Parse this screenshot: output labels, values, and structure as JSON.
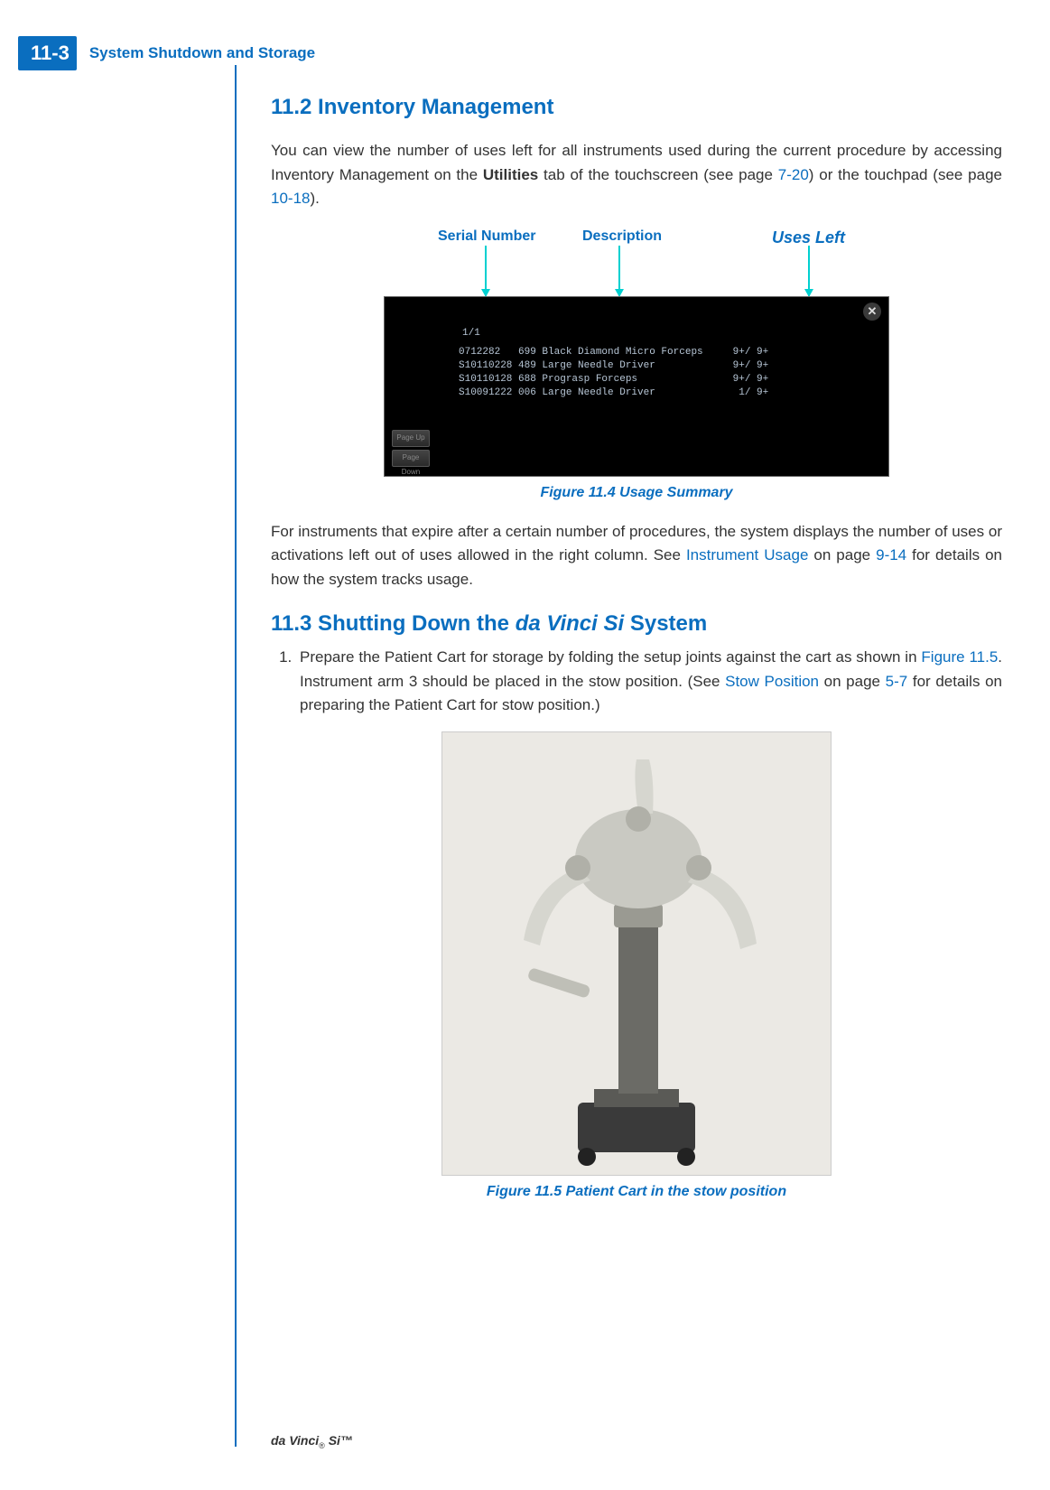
{
  "header": {
    "page_number": "11-3",
    "chapter_title": "System Shutdown and Storage"
  },
  "section_11_2": {
    "heading": "11.2 Inventory Management",
    "para1_a": "You can view the number of uses left for all instruments used during the current procedure by accessing Inventory Management on the ",
    "bold_utilities": "Utilities",
    "para1_b": " tab of the touchscreen (see page ",
    "link_720": "7-20",
    "para1_c": ") or the touchpad (see page ",
    "link_1018": "10-18",
    "para1_d": ")."
  },
  "usage_figure": {
    "label_serial": "Serial Number",
    "label_description": "Description",
    "label_uses": "Uses Left",
    "page_indicator": "1/1",
    "close_glyph": "✕",
    "page_up": "Page Up",
    "page_down": "Page Down",
    "rows": [
      {
        "serial": "0712282",
        "code": "699",
        "desc": "Black Diamond Micro Forceps",
        "uses": "9+/ 9+"
      },
      {
        "serial": "S10110228",
        "code": "489",
        "desc": "Large Needle Driver",
        "uses": "9+/ 9+"
      },
      {
        "serial": "S10110128",
        "code": "688",
        "desc": "Prograsp Forceps",
        "uses": "9+/ 9+"
      },
      {
        "serial": "S10091222",
        "code": "006",
        "desc": "Large Needle Driver",
        "uses": "1/ 9+"
      }
    ],
    "caption": "Figure 11.4 Usage Summary"
  },
  "after_figure": {
    "para_a": "For instruments that expire after a certain number of procedures, the system displays the number of uses or activations left out of uses allowed in the right column. See ",
    "link_instr_usage": "Instrument Usage",
    "para_b": " on page ",
    "link_914": "9-14",
    "para_c": " for details on how the system tracks usage."
  },
  "section_11_3": {
    "heading_a": "11.3 Shutting Down the ",
    "heading_italic": "da Vinci Si",
    "heading_b": " System",
    "step1_a": "Prepare the Patient Cart for storage by folding the setup joints against the cart as shown in ",
    "link_fig115": "Figure 11.5",
    "step1_b": ". Instrument arm 3 should be placed in the stow position. (See ",
    "link_stow": "Stow Position",
    "step1_c": " on page ",
    "link_57": "5-7",
    "step1_d": " for details on preparing the Patient Cart for stow position.)"
  },
  "cart_figure": {
    "caption": "Figure 11.5 Patient Cart in the stow position"
  },
  "footer": {
    "text_a": "da Vinci",
    "reg": "®",
    "text_b": " Si™"
  }
}
